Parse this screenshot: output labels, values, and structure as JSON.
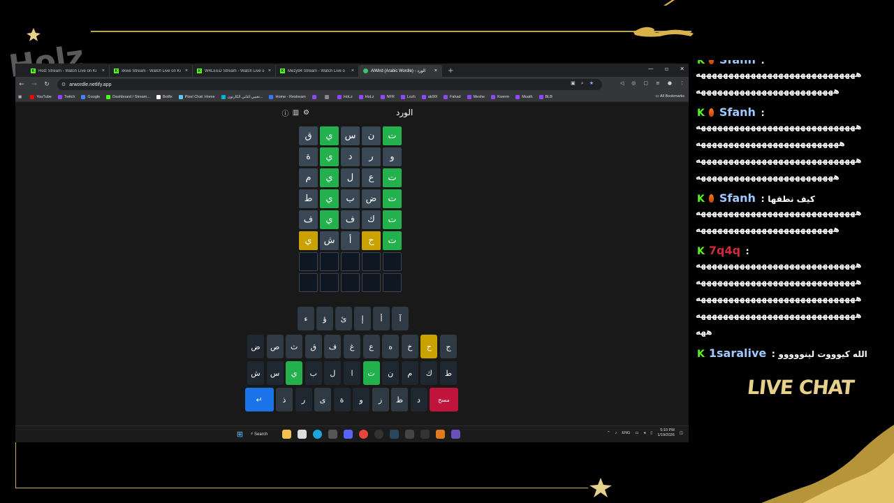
{
  "overlay": {
    "logo_text": "Holz",
    "live_chat_label": "LIVE CHAT",
    "gold_color": "#c9ab5a"
  },
  "browser": {
    "tabs": [
      {
        "title": "Holz Stream - Watch Live on Ki",
        "icon": "kick-icon"
      },
      {
        "title": "xkwe Stream - Watch Live on Ki",
        "icon": "kick-icon"
      },
      {
        "title": "W4LEED Stream - Watch Live o",
        "icon": "kick-icon"
      },
      {
        "title": "Mezy94 Stream - Watch Live o",
        "icon": "kick-icon"
      },
      {
        "title": "AlWird (Arabic Wordle) - الورد",
        "icon": "globe-icon",
        "active": true
      }
    ],
    "url": "arwordle.netlify.app",
    "bookmarks": [
      {
        "label": "YouTube",
        "color": "#ff0000"
      },
      {
        "label": "Twitch",
        "color": "#9146ff"
      },
      {
        "label": "Google",
        "color": "#4285f4"
      },
      {
        "label": "Dashboard / Stream...",
        "color": "#53fc18"
      },
      {
        "label": "Botfix",
        "color": "#ffffff"
      },
      {
        "label": "Pixel Chat: Home",
        "color": "#5ac8fa"
      },
      {
        "label": "تغنيي اغاني الكارتون...",
        "color": "#00b4d8"
      },
      {
        "label": "Home - Restream",
        "color": "#3478f6"
      },
      {
        "label": "",
        "color": "#9146ff"
      },
      {
        "label": "",
        "color": "#888888"
      },
      {
        "label": "HoLz",
        "color": "#9146ff"
      },
      {
        "label": "HoLz",
        "color": "#9146ff"
      },
      {
        "label": "NFR",
        "color": "#9146ff"
      },
      {
        "label": "Lozh",
        "color": "#9146ff"
      },
      {
        "label": "ak90l",
        "color": "#9146ff"
      },
      {
        "label": "Fahad",
        "color": "#9146ff"
      },
      {
        "label": "Meshe",
        "color": "#9146ff"
      },
      {
        "label": "Kwerm",
        "color": "#9146ff"
      },
      {
        "label": "Muath",
        "color": "#9146ff"
      },
      {
        "label": "BLB",
        "color": "#9146ff"
      }
    ],
    "all_bookmarks_label": "All Bookmarks"
  },
  "game": {
    "title": "الورد",
    "grid": [
      [
        {
          "l": "ت",
          "s": "correct"
        },
        {
          "l": "ن",
          "s": "absent"
        },
        {
          "l": "س",
          "s": "absent"
        },
        {
          "l": "ي",
          "s": "correct"
        },
        {
          "l": "ق",
          "s": "absent"
        }
      ],
      [
        {
          "l": "و",
          "s": "absent"
        },
        {
          "l": "ر",
          "s": "absent"
        },
        {
          "l": "د",
          "s": "absent"
        },
        {
          "l": "ي",
          "s": "correct"
        },
        {
          "l": "ة",
          "s": "absent"
        }
      ],
      [
        {
          "l": "ت",
          "s": "correct"
        },
        {
          "l": "ع",
          "s": "absent"
        },
        {
          "l": "ل",
          "s": "absent"
        },
        {
          "l": "ي",
          "s": "correct"
        },
        {
          "l": "م",
          "s": "absent"
        }
      ],
      [
        {
          "l": "ت",
          "s": "correct"
        },
        {
          "l": "ض",
          "s": "absent"
        },
        {
          "l": "ب",
          "s": "absent"
        },
        {
          "l": "ي",
          "s": "correct"
        },
        {
          "l": "ط",
          "s": "absent"
        }
      ],
      [
        {
          "l": "ت",
          "s": "correct"
        },
        {
          "l": "ك",
          "s": "absent"
        },
        {
          "l": "ف",
          "s": "absent"
        },
        {
          "l": "ي",
          "s": "correct"
        },
        {
          "l": "ف",
          "s": "absent"
        }
      ],
      [
        {
          "l": "ت",
          "s": "correct"
        },
        {
          "l": "ح",
          "s": "present"
        },
        {
          "l": "أ",
          "s": "absent"
        },
        {
          "l": "ش",
          "s": "absent"
        },
        {
          "l": "ي",
          "s": "present"
        }
      ],
      [
        {
          "l": "",
          "s": "empty"
        },
        {
          "l": "",
          "s": "empty"
        },
        {
          "l": "",
          "s": "empty"
        },
        {
          "l": "",
          "s": "empty"
        },
        {
          "l": "",
          "s": "empty"
        }
      ],
      [
        {
          "l": "",
          "s": "empty"
        },
        {
          "l": "",
          "s": "empty"
        },
        {
          "l": "",
          "s": "empty"
        },
        {
          "l": "",
          "s": "empty"
        },
        {
          "l": "",
          "s": "empty"
        }
      ]
    ],
    "keyboard": [
      [
        {
          "l": "آ",
          "s": "key"
        },
        {
          "l": "أ",
          "s": "key"
        },
        {
          "l": "إ",
          "s": "key"
        },
        {
          "l": "ئ",
          "s": "key"
        },
        {
          "l": "ؤ",
          "s": "key"
        },
        {
          "l": "ء",
          "s": "key"
        }
      ],
      [
        {
          "l": "ج",
          "s": "key"
        },
        {
          "l": "ح",
          "s": "present"
        },
        {
          "l": "خ",
          "s": "key"
        },
        {
          "l": "ه",
          "s": "key"
        },
        {
          "l": "ع",
          "s": "key"
        },
        {
          "l": "غ",
          "s": "key"
        },
        {
          "l": "ف",
          "s": "key"
        },
        {
          "l": "ق",
          "s": "key"
        },
        {
          "l": "ث",
          "s": "key"
        },
        {
          "l": "ص",
          "s": "key"
        },
        {
          "l": "ض",
          "s": "dark"
        }
      ],
      [
        {
          "l": "ط",
          "s": "dark"
        },
        {
          "l": "ك",
          "s": "dark"
        },
        {
          "l": "م",
          "s": "dark"
        },
        {
          "l": "ن",
          "s": "dark"
        },
        {
          "l": "ت",
          "s": "correct"
        },
        {
          "l": "ا",
          "s": "dark"
        },
        {
          "l": "ل",
          "s": "dark"
        },
        {
          "l": "ب",
          "s": "dark"
        },
        {
          "l": "ي",
          "s": "correct"
        },
        {
          "l": "س",
          "s": "dark"
        },
        {
          "l": "ش",
          "s": "dark"
        }
      ],
      [
        {
          "l": "مسح",
          "s": "del"
        },
        {
          "l": "د",
          "s": "dark"
        },
        {
          "l": "ظ",
          "s": "key"
        },
        {
          "l": "ز",
          "s": "key"
        },
        {
          "l": "و",
          "s": "dark"
        },
        {
          "l": "ة",
          "s": "dark"
        },
        {
          "l": "ى",
          "s": "key"
        },
        {
          "l": "ر",
          "s": "dark"
        },
        {
          "l": "ذ",
          "s": "key"
        },
        {
          "l": "↵",
          "s": "enter"
        }
      ]
    ],
    "colors": {
      "correct": "#22b14c",
      "present": "#c9a100",
      "absent": "#3a4754"
    }
  },
  "taskbar": {
    "search_label": "Search",
    "lang": "ENG",
    "time": "5:10 PM",
    "date": "1/19/2026"
  },
  "chat": {
    "messages": [
      {
        "user": "Sfanh",
        "color": "#9ec8ff",
        "fire": true,
        "text": "",
        "lines": [
          "هههههههههههههههههههههههههههههه",
          "هههههههههههههههههههههههههه"
        ]
      },
      {
        "user": "Sfanh",
        "color": "#9ec8ff",
        "fire": true,
        "text": "",
        "lines": [
          "هههههههههههههههههههههههههههههه",
          "ههههههههههههههههههههههههههه",
          "هههههههههههههههههههههههههههههه",
          "هههههههههههههههههههههههههه"
        ]
      },
      {
        "user": "Sfanh",
        "color": "#9ec8ff",
        "fire": true,
        "text": "كيف نطقها",
        "lines": [
          "هههههههههههههههههههههههههههههه",
          "هههههههههههههههههههههههههه"
        ]
      },
      {
        "user": "7q4q",
        "color": "#d12a3d",
        "fire": false,
        "text": "",
        "lines": [
          "هههههههههههههههههههههههههههههه",
          "هههههههههههههههههههههههههههههه",
          "هههههههههههههههههههههههههههههه",
          "هههههههههههههههههههههههههههههه",
          "ههه"
        ]
      },
      {
        "user": "1saralive",
        "color": "#9ec8ff",
        "fire": false,
        "text": "الله كيوووت لينووووو",
        "lines": []
      }
    ]
  }
}
